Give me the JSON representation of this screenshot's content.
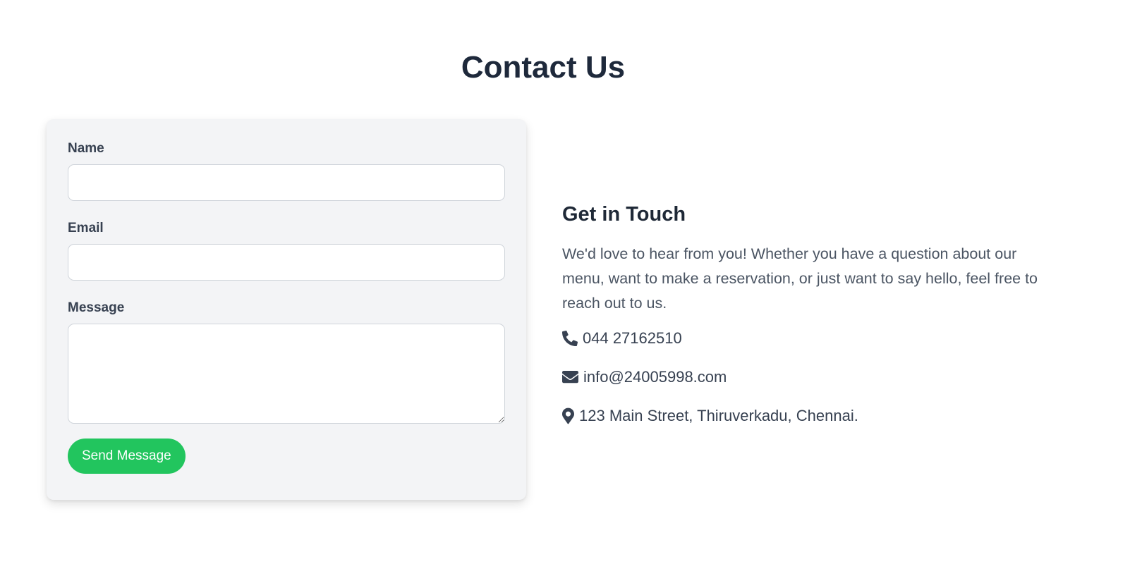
{
  "page": {
    "title": "Contact Us"
  },
  "form": {
    "name_label": "Name",
    "name_value": "",
    "email_label": "Email",
    "email_value": "",
    "message_label": "Message",
    "message_value": "",
    "submit_label": "Send Message",
    "submit_color": "#22c55e"
  },
  "info": {
    "heading": "Get in Touch",
    "description": "We'd love to hear from you! Whether you have a question about our menu, want to make a reservation, or just want to say hello, feel free to reach out to us.",
    "items": [
      {
        "icon": "phone-icon",
        "text": "044 27162510"
      },
      {
        "icon": "envelope-icon",
        "text": "info@24005998.com"
      },
      {
        "icon": "map-marker-icon",
        "text": "123 Main Street, Thiruverkadu, Chennai."
      }
    ]
  }
}
